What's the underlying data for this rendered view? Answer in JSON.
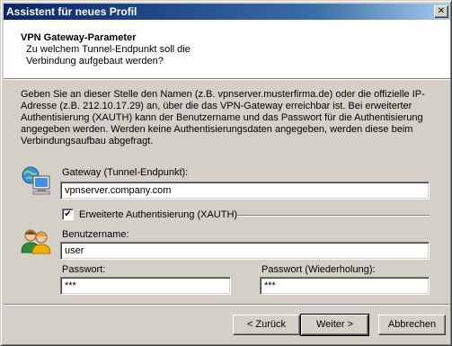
{
  "window": {
    "title": "Assistent für neues Profil",
    "close_glyph": "✕"
  },
  "header": {
    "title": "VPN Gateway-Parameter",
    "subtitle": "Zu welchem Tunnel-Endpunkt soll die Verbindung aufgebaut werden?"
  },
  "description": "Geben Sie an dieser Stelle den Namen (z.B. vpnserver.musterfirma.de) oder die offizielle IP-Adresse (z.B. 212.10.17.29) an, über die das VPN-Gateway erreichbar ist. Bei erweiterter Authentisierung (XAUTH) kann der Benutzername und das Passwort für die Authentisierung angegeben werden. Werden keine Authentisierungsdaten angegeben, werden diese beim Verbindungsaufbau abgefragt.",
  "gateway": {
    "icon": "network-computer-icon",
    "label": "Gateway (Tunnel-Endpunkt):",
    "value": "vpnserver.company.com"
  },
  "xauth": {
    "label": "Erweiterte Authentisierung (XAUTH)",
    "checked": true,
    "check_glyph": "✔"
  },
  "user": {
    "icon": "users-icon",
    "label": "Benutzername:",
    "value": "user"
  },
  "password": {
    "label": "Passwort:",
    "value": "***"
  },
  "password_repeat": {
    "label": "Passwort (Wiederholung):",
    "value": "***"
  },
  "buttons": {
    "back": "< Zurück",
    "next": "Weiter >",
    "cancel": "Abbrechen"
  }
}
